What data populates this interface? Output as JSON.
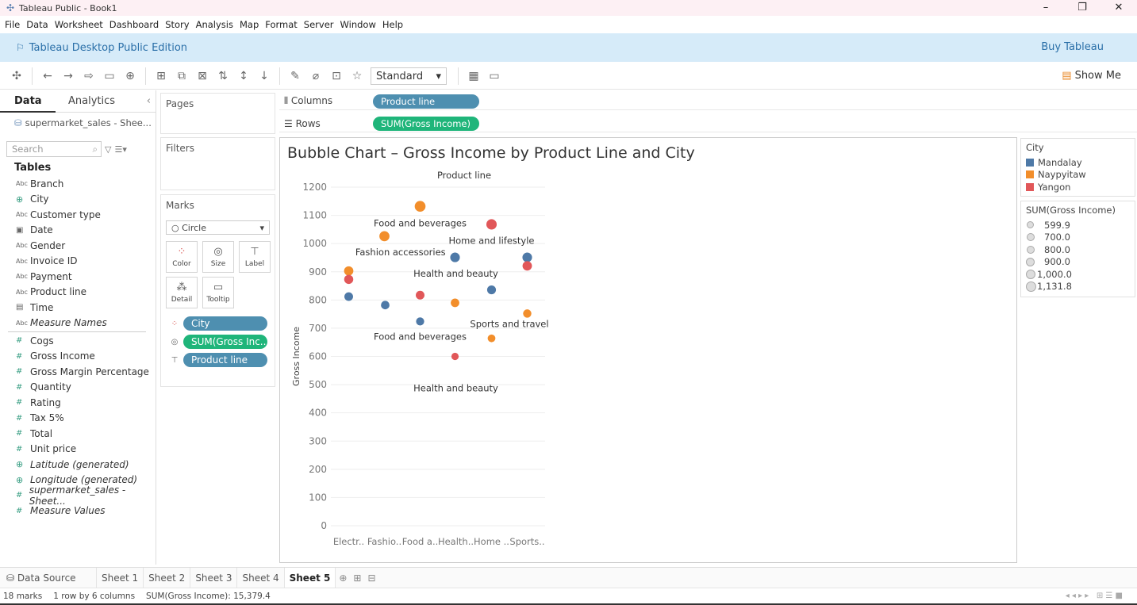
{
  "window": {
    "title": "Tableau Public - Book1",
    "controls": [
      "–",
      "❐",
      "✕"
    ]
  },
  "menu": [
    "File",
    "Data",
    "Worksheet",
    "Dashboard",
    "Story",
    "Analysis",
    "Map",
    "Format",
    "Server",
    "Window",
    "Help"
  ],
  "banner": {
    "edition": "Tableau Desktop Public Edition",
    "buy": "Buy Tableau"
  },
  "toolbar": {
    "fit": "Standard",
    "show_me": "Show Me"
  },
  "data_pane": {
    "tab_data": "Data",
    "tab_analytics": "Analytics",
    "source": "supermarket_sales - Shee...",
    "search_placeholder": "Search",
    "tables_header": "Tables",
    "dimensions": [
      {
        "icon": "Abc",
        "name": "Branch"
      },
      {
        "icon": "geo",
        "name": "City"
      },
      {
        "icon": "Abc",
        "name": "Customer type"
      },
      {
        "icon": "date",
        "name": "Date"
      },
      {
        "icon": "Abc",
        "name": "Gender"
      },
      {
        "icon": "Abc",
        "name": "Invoice ID"
      },
      {
        "icon": "Abc",
        "name": "Payment"
      },
      {
        "icon": "Abc",
        "name": "Product line"
      },
      {
        "icon": "time",
        "name": "Time"
      },
      {
        "icon": "Abc",
        "name": "Measure Names"
      }
    ],
    "measures": [
      {
        "icon": "#",
        "name": "Cogs"
      },
      {
        "icon": "#",
        "name": "Gross Income"
      },
      {
        "icon": "#",
        "name": "Gross Margin Percentage"
      },
      {
        "icon": "#",
        "name": "Quantity"
      },
      {
        "icon": "#",
        "name": "Rating"
      },
      {
        "icon": "#",
        "name": "Tax 5%"
      },
      {
        "icon": "#",
        "name": "Total"
      },
      {
        "icon": "#",
        "name": "Unit price"
      },
      {
        "icon": "geo",
        "name": "Latitude (generated)"
      },
      {
        "icon": "geo",
        "name": "Longitude (generated)"
      },
      {
        "icon": "#",
        "name": "supermarket_sales - Sheet..."
      },
      {
        "icon": "#",
        "name": "Measure Values"
      }
    ]
  },
  "cards": {
    "pages": "Pages",
    "filters": "Filters",
    "marks": "Marks",
    "mark_type": "Circle",
    "mark_buttons": [
      "Color",
      "Size",
      "Label",
      "Detail",
      "Tooltip"
    ],
    "mark_pills": [
      {
        "icon": "color",
        "label": "City",
        "kind": "blue"
      },
      {
        "icon": "size",
        "label": "SUM(Gross Inc..",
        "kind": "green"
      },
      {
        "icon": "label",
        "label": "Product line",
        "kind": "blue"
      }
    ]
  },
  "shelves": {
    "columns_label": "Columns",
    "columns_pill": "Product line",
    "rows_label": "Rows",
    "rows_pill": "SUM(Gross Income)"
  },
  "legend_color": {
    "title": "City",
    "items": [
      {
        "label": "Mandalay",
        "color": "#4e79a7"
      },
      {
        "label": "Naypyitaw",
        "color": "#f28e2b"
      },
      {
        "label": "Yangon",
        "color": "#e15759"
      }
    ]
  },
  "legend_size": {
    "title": "SUM(Gross Income)",
    "items": [
      "599.9",
      "700.0",
      "800.0",
      "900.0",
      "1,000.0",
      "1,131.8"
    ]
  },
  "chart_data": {
    "type": "scatter",
    "title": "Bubble Chart – Gross Income by Product Line and City",
    "header": "Product line",
    "ylabel": "Gross Income",
    "ylim": [
      0,
      1200
    ],
    "yticks": [
      0,
      100,
      200,
      300,
      400,
      500,
      600,
      700,
      800,
      900,
      1000,
      1100,
      1200
    ],
    "categories": [
      "Electr..",
      "Fashio..",
      "Food a..",
      "Health..",
      "Home ..",
      "Sports.."
    ],
    "points": [
      {
        "cat": 0,
        "dx": 0,
        "y": 903,
        "city": "Naypyitaw"
      },
      {
        "cat": 0,
        "dx": 0,
        "y": 873,
        "city": "Yangon"
      },
      {
        "cat": 0,
        "dx": 0,
        "y": 812,
        "city": "Mandalay"
      },
      {
        "cat": 1,
        "dx": 0,
        "y": 1026,
        "city": "Naypyitaw"
      },
      {
        "cat": 1,
        "dx": 1,
        "y": 782,
        "city": "Mandalay"
      },
      {
        "cat": 2,
        "dx": 0,
        "y": 1132,
        "city": "Naypyitaw"
      },
      {
        "cat": 2,
        "dx": 0,
        "y": 817,
        "city": "Yangon"
      },
      {
        "cat": 2,
        "dx": 0,
        "y": 724,
        "city": "Mandalay"
      },
      {
        "cat": 3,
        "dx": -1,
        "y": 951,
        "city": "Mandalay"
      },
      {
        "cat": 3,
        "dx": -1,
        "y": 790,
        "city": "Naypyitaw"
      },
      {
        "cat": 3,
        "dx": -1,
        "y": 600,
        "city": "Yangon"
      },
      {
        "cat": 4,
        "dx": 0,
        "y": 1068,
        "city": "Yangon"
      },
      {
        "cat": 4,
        "dx": 0,
        "y": 836,
        "city": "Mandalay"
      },
      {
        "cat": 4,
        "dx": 0,
        "y": 664,
        "city": "Naypyitaw"
      },
      {
        "cat": 5,
        "dx": 0,
        "y": 951,
        "city": "Mandalay"
      },
      {
        "cat": 5,
        "dx": 0,
        "y": 921,
        "city": "Yangon"
      },
      {
        "cat": 5,
        "dx": 0,
        "y": 752,
        "city": "Naypyitaw"
      }
    ],
    "labels": [
      {
        "text": "Food and beverages",
        "cat": 2,
        "y": 1072
      },
      {
        "text": "Home and lifestyle",
        "cat": 4,
        "y": 1010
      },
      {
        "text": "Fashion accessories",
        "cat": 1.45,
        "y": 970
      },
      {
        "text": "Health and beauty",
        "cat": 3,
        "y": 893
      },
      {
        "text": "Sports and travel",
        "cat": 4.5,
        "y": 715
      },
      {
        "text": "Food and beverages",
        "cat": 2,
        "y": 670
      },
      {
        "text": "Health and beauty",
        "cat": 3,
        "y": 487
      }
    ]
  },
  "sheet_tabs": {
    "data_source": "Data Source",
    "sheets": [
      "Sheet 1",
      "Sheet 2",
      "Sheet 3",
      "Sheet 4",
      "Sheet 5"
    ],
    "active": "Sheet 5"
  },
  "status": {
    "marks": "18 marks",
    "layout": "1 row by 6 columns",
    "sum": "SUM(Gross Income): 15,379.4"
  }
}
